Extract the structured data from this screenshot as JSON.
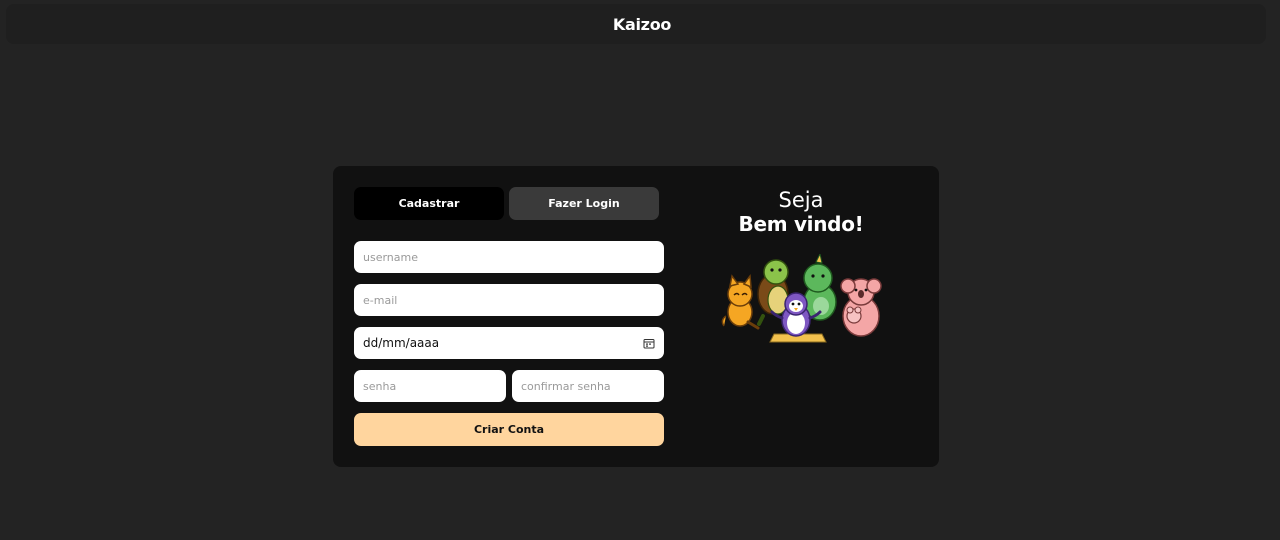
{
  "header": {
    "title": "Kaizoo"
  },
  "tabs": {
    "register": "Cadastrar",
    "login": "Fazer Login"
  },
  "form": {
    "username_placeholder": "username",
    "email_placeholder": "e-mail",
    "birthdate_value": "dd/mm/aaaa",
    "password_placeholder": "senha",
    "confirm_password_placeholder": "confirmar senha",
    "submit_label": "Criar Conta"
  },
  "welcome": {
    "line1": "Seja",
    "line2": "Bem vindo!"
  },
  "colors": {
    "accent": "#ffd59e",
    "card": "#111111",
    "background": "#232323"
  },
  "icons": {
    "calendar": "calendar-icon",
    "illustration": "animals-illustration"
  }
}
